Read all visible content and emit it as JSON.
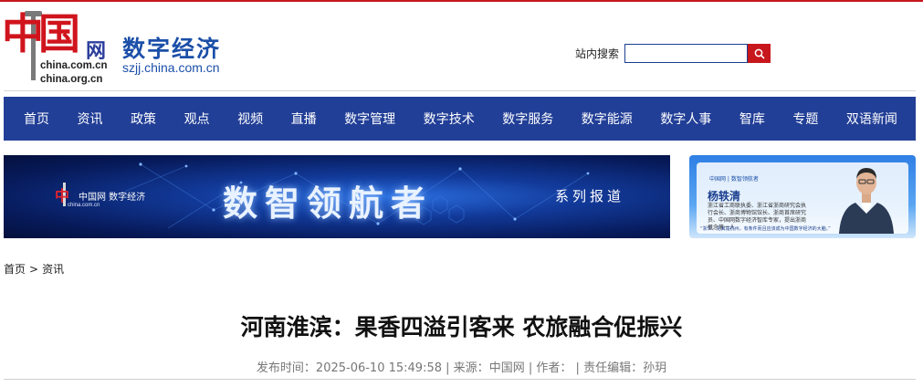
{
  "header": {
    "logo_char": "中国",
    "logo_wang": "网",
    "logo_domain_1": "china.com.cn",
    "logo_domain_2": "china.org.cn",
    "site_title": "数字经济",
    "site_domain": "szjj.china.com.cn",
    "search_label": "站内搜索",
    "search_value": ""
  },
  "nav": {
    "items": [
      "首页",
      "资讯",
      "政策",
      "观点",
      "视频",
      "直播",
      "数字管理",
      "数字技术",
      "数字服务",
      "数字能源",
      "数字人事",
      "智库",
      "专题",
      "双语新闻"
    ]
  },
  "banner": {
    "logo_text": "中国网 数字经济",
    "logo_domain": "china.com.cn",
    "title": "数智领航者",
    "series": "系列报道"
  },
  "side_banner": {
    "brand": "中国网 | 数智领航者",
    "name": "杨轶清",
    "description": "浙江省工商联执委、浙江省浙商研究会执行会长、浙商博物馆馆长、浙商首席研究员、中国网数字经济智库专家，提出浙商概念第一人",
    "quote": "“浙江、尤其是杭州，有条件而且应该成为中国数字经济的大脑。”"
  },
  "breadcrumb": {
    "home": "首页",
    "separator": ">",
    "current": "资讯"
  },
  "article": {
    "title": "河南淮滨：果香四溢引客来 农旅融合促振兴",
    "publish_label": "发布时间：",
    "publish_time": "2025-06-10 15:49:58",
    "source_label": "来源：",
    "source": "中国网",
    "author_label": "作者：",
    "author": "",
    "editor_label": "责任编辑：",
    "editor": "孙玥"
  },
  "colors": {
    "brand_red": "#c7171d",
    "nav_blue": "#223f97",
    "title_blue": "#1b4fa8"
  }
}
